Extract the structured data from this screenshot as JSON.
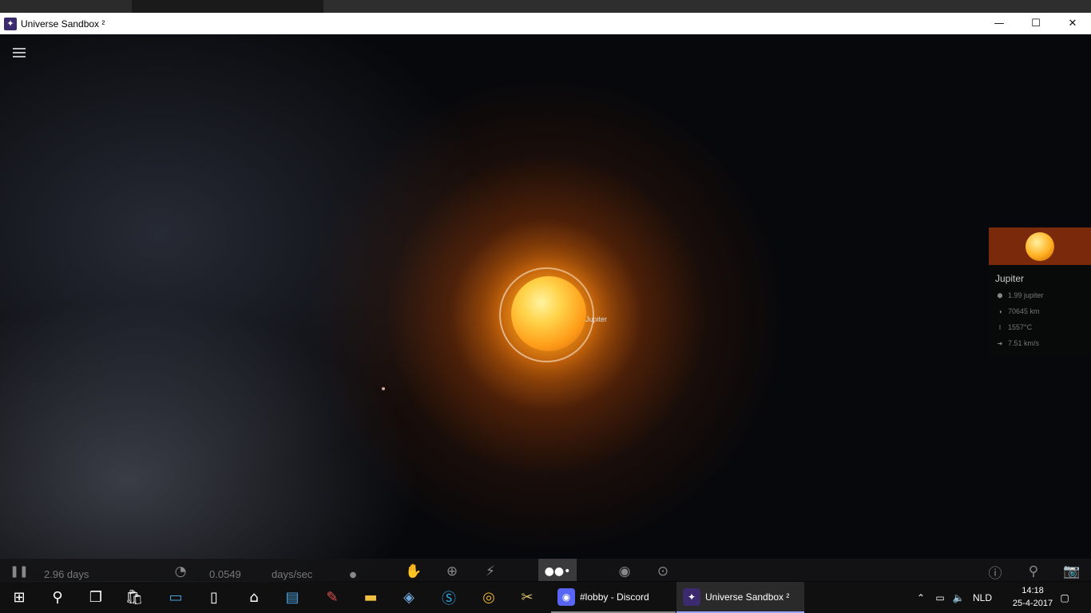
{
  "window": {
    "title": "Universe Sandbox ²",
    "minimize": "—",
    "maximize": "☐",
    "close": "✕"
  },
  "scene": {
    "planet_label": "Jupiter",
    "menu_icon": "hamburger-menu-icon"
  },
  "info_panel": {
    "name": "Jupiter",
    "rows": [
      {
        "icon": "mass-icon",
        "glyph": "⬢",
        "value": "1.99 jupiter"
      },
      {
        "icon": "radius-icon",
        "glyph": "◑",
        "value": "70645 km"
      },
      {
        "icon": "temperature-icon",
        "glyph": "🌡",
        "value": "1557°C"
      },
      {
        "icon": "velocity-icon",
        "glyph": "➜",
        "value": "7.51 km/s"
      }
    ]
  },
  "bottom_bar": {
    "pause_icon": "pause-icon",
    "elapsed": "2.96 days",
    "speed_value": "0.0549",
    "speed_unit": "days/sec",
    "labels": {
      "view": "view",
      "sim": "sim",
      "stats": "stats",
      "search": "search",
      "photo": "photo"
    }
  },
  "taskbar": {
    "apps": [
      {
        "name": "#lobby - Discord"
      },
      {
        "name": "Universe Sandbox ²"
      }
    ],
    "language": "NLD",
    "time": "14:18",
    "date": "25-4-2017"
  }
}
